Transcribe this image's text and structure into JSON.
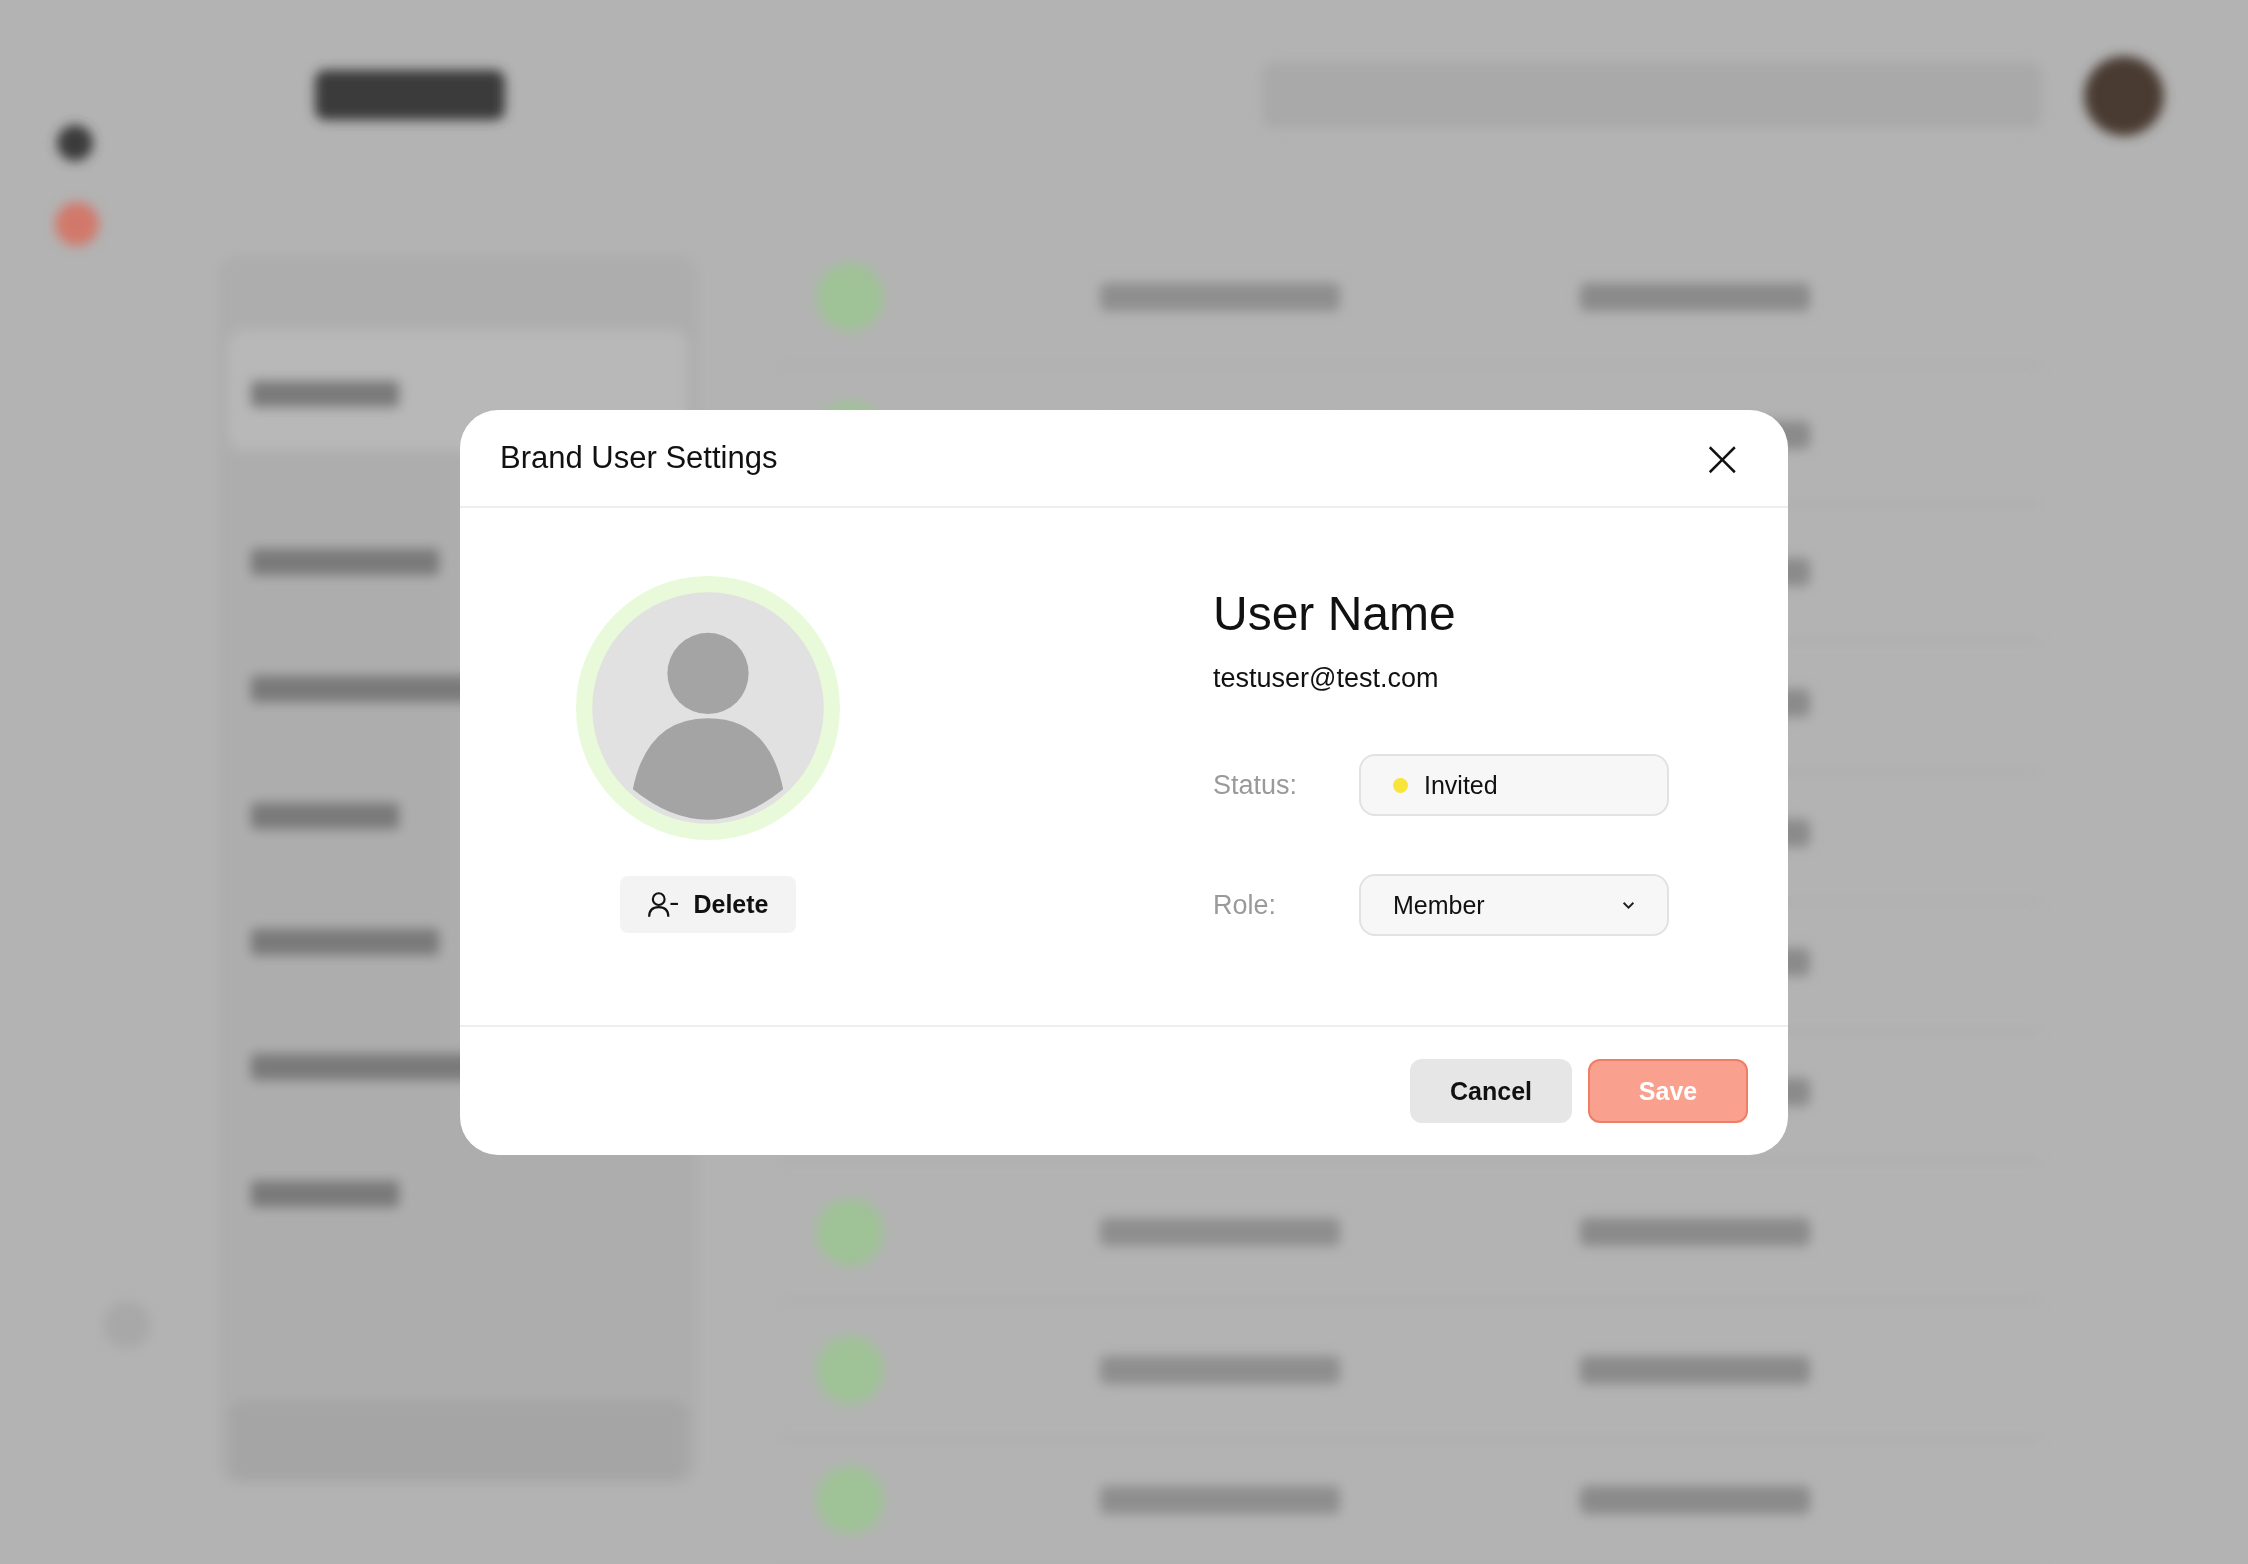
{
  "dialog": {
    "title": "Brand User Settings",
    "close": "×",
    "delete_button": "Delete",
    "user_name": "User Name",
    "email": "testuser@test.com",
    "fields": [
      {
        "kind": "status",
        "label": "Status:",
        "value": "Invited",
        "color": "#f7e53b"
      },
      {
        "kind": "select",
        "label": "Role:",
        "value": "Member"
      }
    ],
    "buttons": [
      {
        "kind": "secondary",
        "label": "Cancel"
      },
      {
        "kind": "primary",
        "label": "Save"
      }
    ]
  }
}
